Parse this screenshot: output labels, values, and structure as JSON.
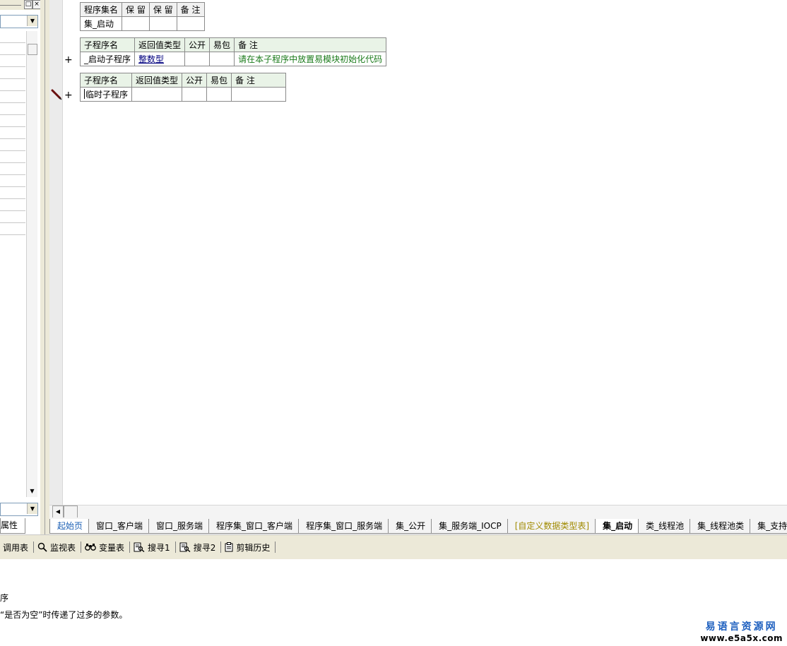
{
  "left_panel": {
    "restore_button": "□",
    "close_button": "×",
    "combo_arrow": "▼",
    "scroll_up": "▲",
    "scroll_down": "▼",
    "tab_label": "属性"
  },
  "program_set_table": {
    "headers": [
      "程序集名",
      "保 留",
      "保 留",
      "备 注"
    ],
    "row": [
      "集_启动",
      "",
      "",
      ""
    ]
  },
  "sub_table_1": {
    "headers": [
      "子程序名",
      "返回值类型",
      "公开",
      "易包",
      "备 注"
    ],
    "name": "_启动子程序",
    "return_type": "整数型",
    "public": "",
    "epackage": "",
    "remark": "请在本子程序中放置易模块初始化代码"
  },
  "sub_table_2": {
    "headers": [
      "子程序名",
      "返回值类型",
      "公开",
      "易包",
      "备 注"
    ],
    "name": "临时子程序",
    "return_type": "",
    "public": "",
    "epackage": "",
    "remark": ""
  },
  "gutter": {
    "plus": "+"
  },
  "hscroll": {
    "left_arrow": "◀"
  },
  "tabs": [
    "起始页",
    "窗口_客户端",
    "窗口_服务端",
    "程序集_窗口_客户端",
    "程序集_窗口_服务端",
    "集_公开",
    "集_服务端_IOCP",
    "[自定义数据类型表]",
    "集_启动",
    "类_线程池",
    "集_线程池类",
    "集_支持"
  ],
  "toolbar": {
    "items": [
      "调用表",
      "监视表",
      "变量表",
      "搜寻1",
      "搜寻2",
      "剪辑历史"
    ]
  },
  "output": {
    "line1": "序",
    "line2": "“是否为空”时传递了过多的参数。"
  },
  "watermark": {
    "cn": "易语言资源网",
    "url": "www.e5a5x.com"
  },
  "colors": {
    "header_green": "#e9f3e7",
    "type_blue": "#00007f",
    "remark_green": "#1a7a1a",
    "watermark_blue": "#1d5fbf"
  }
}
